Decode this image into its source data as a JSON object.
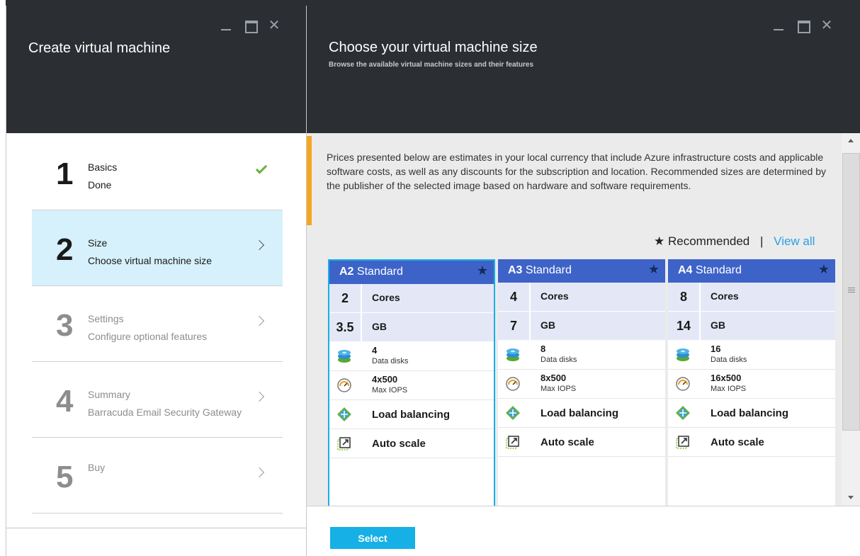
{
  "left_blade": {
    "title": "Create virtual machine",
    "steps": [
      {
        "num": "1",
        "title": "Basics",
        "subtitle": "Done",
        "state": "done"
      },
      {
        "num": "2",
        "title": "Size",
        "subtitle": "Choose virtual machine size",
        "state": "active"
      },
      {
        "num": "3",
        "title": "Settings",
        "subtitle": "Configure optional features",
        "state": "disabled"
      },
      {
        "num": "4",
        "title": "Summary",
        "subtitle": "Barracuda Email Security Gateway",
        "state": "disabled"
      },
      {
        "num": "5",
        "title": "Buy",
        "subtitle": "",
        "state": "disabled"
      }
    ]
  },
  "right_blade": {
    "title": "Choose your virtual machine size",
    "subtitle": "Browse the available virtual machine sizes and their features",
    "info_text": "Prices presented below are estimates in your local currency that include Azure infrastructure costs and applicable software costs, as well as any discounts for the subscription and location. Recommended sizes are determined by the publisher of the selected image based on hardware and software requirements.",
    "recommended_label": "Recommended",
    "separator": "|",
    "view_all_label": "View all",
    "select_label": "Select",
    "cards": [
      {
        "code": "A2",
        "tier": "Standard",
        "cores": "2",
        "cores_label": "Cores",
        "ram": "3.5",
        "ram_label": "GB",
        "disks": "4",
        "disks_label": "Data disks",
        "iops": "4x500",
        "iops_label": "Max IOPS",
        "lb_label": "Load balancing",
        "autoscale_label": "Auto scale",
        "selected": true
      },
      {
        "code": "A3",
        "tier": "Standard",
        "cores": "4",
        "cores_label": "Cores",
        "ram": "7",
        "ram_label": "GB",
        "disks": "8",
        "disks_label": "Data disks",
        "iops": "8x500",
        "iops_label": "Max IOPS",
        "lb_label": "Load balancing",
        "autoscale_label": "Auto scale",
        "selected": false
      },
      {
        "code": "A4",
        "tier": "Standard",
        "cores": "8",
        "cores_label": "Cores",
        "ram": "14",
        "ram_label": "GB",
        "disks": "16",
        "disks_label": "Data disks",
        "iops": "16x500",
        "iops_label": "Max IOPS",
        "lb_label": "Load balancing",
        "autoscale_label": "Auto scale",
        "selected": false
      }
    ]
  },
  "icons": {
    "recommended": "star-icon",
    "disk": "disk-stack-icon",
    "iops": "gauge-icon",
    "load_balancing": "load-balancing-icon",
    "auto_scale": "auto-scale-icon"
  },
  "colors": {
    "header_bg": "#2b2f33",
    "accent": "#16b0e6",
    "card_header": "#3e63c8",
    "active_step": "#d6f1fb",
    "done_check": "#6bb03b",
    "info_bar": "#f5a623",
    "link": "#2ba0e3"
  }
}
